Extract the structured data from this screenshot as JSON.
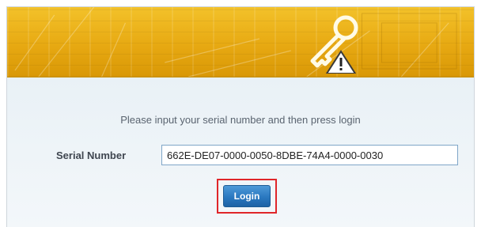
{
  "banner": {
    "icon": "key-warning-icon"
  },
  "form": {
    "prompt": "Please input your serial number and then press login",
    "serial_label": "Serial Number",
    "serial_value": "662E-DE07-0000-0050-8DBE-74A4-0000-0030",
    "login_label": "Login"
  },
  "colors": {
    "banner": "#e7a912",
    "login_button": "#2a78c0",
    "highlight_box": "#e0262a"
  }
}
